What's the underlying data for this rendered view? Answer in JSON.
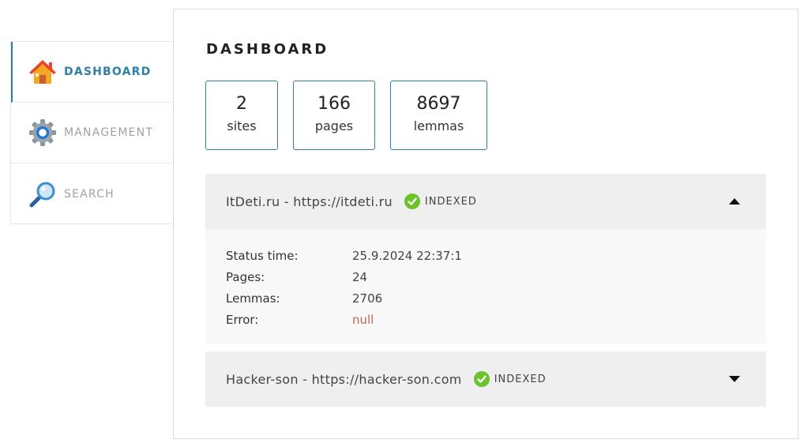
{
  "sidebar": {
    "items": [
      {
        "label": "DASHBOARD",
        "icon": "home-icon",
        "active": true
      },
      {
        "label": "MANAGEMENT",
        "icon": "gear-icon",
        "active": false
      },
      {
        "label": "SEARCH",
        "icon": "magnifier-icon",
        "active": false
      }
    ]
  },
  "main": {
    "title": "DASHBOARD",
    "stats": [
      {
        "value": "2",
        "label": "sites"
      },
      {
        "value": "166",
        "label": "pages"
      },
      {
        "value": "8697",
        "label": "lemmas"
      }
    ],
    "sites": [
      {
        "title": "ItDeti.ru - https://itdeti.ru",
        "status": "INDEXED",
        "expanded": true,
        "details": [
          {
            "key": "Status time:",
            "value": "25.9.2024 22:37:1"
          },
          {
            "key": "Pages:",
            "value": "24"
          },
          {
            "key": "Lemmas:",
            "value": "2706"
          },
          {
            "key": "Error:",
            "value": "null"
          }
        ]
      },
      {
        "title": "Hacker-son - https://hacker-son.com",
        "status": "INDEXED",
        "expanded": false
      }
    ]
  },
  "colors": {
    "accent": "#2f7fa8",
    "status_ok": "#6cc22a",
    "error_text": "#b86a55"
  }
}
